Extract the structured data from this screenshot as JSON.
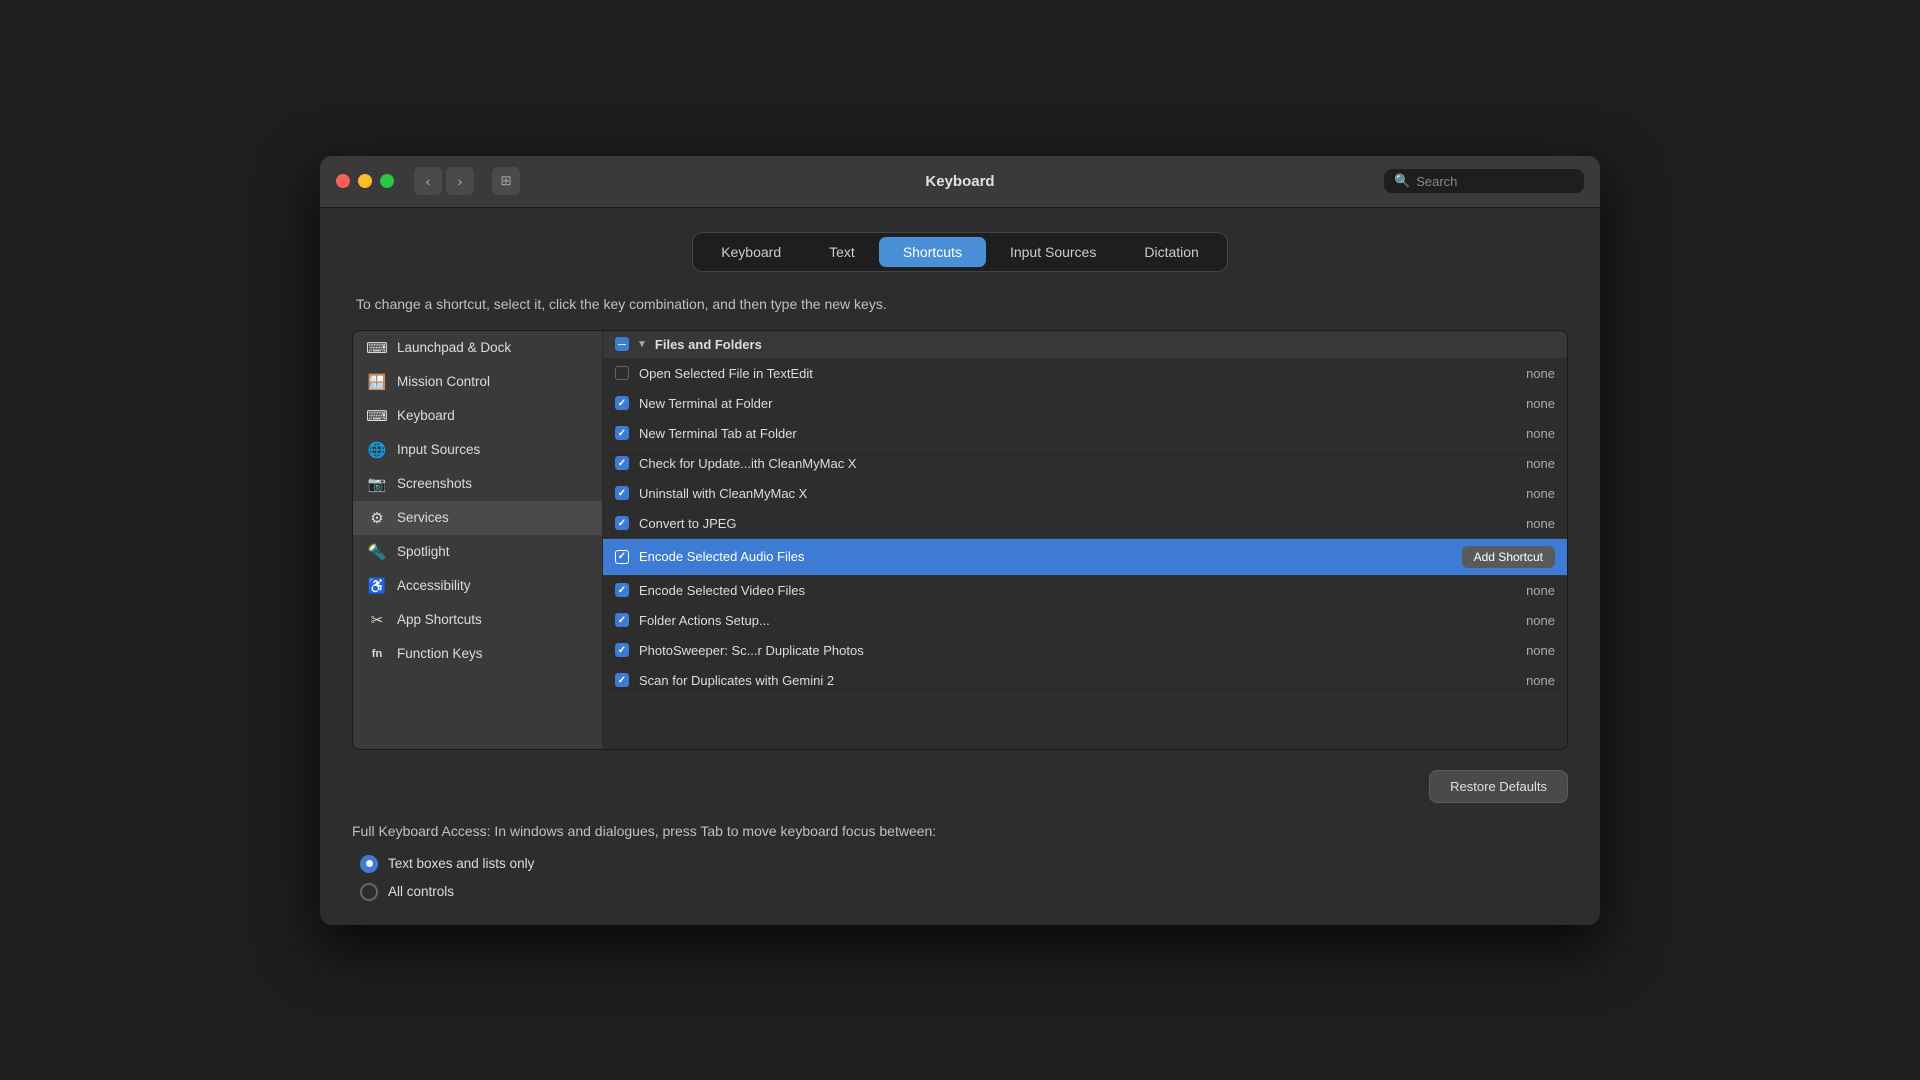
{
  "window": {
    "title": "Keyboard",
    "search_placeholder": "Search"
  },
  "tabs": [
    {
      "id": "keyboard",
      "label": "Keyboard",
      "active": false
    },
    {
      "id": "text",
      "label": "Text",
      "active": false
    },
    {
      "id": "shortcuts",
      "label": "Shortcuts",
      "active": true
    },
    {
      "id": "input-sources",
      "label": "Input Sources",
      "active": false
    },
    {
      "id": "dictation",
      "label": "Dictation",
      "active": false
    }
  ],
  "instruction": "To change a shortcut, select it, click the key combination, and then type the new keys.",
  "sidebar": {
    "items": [
      {
        "id": "launchpad",
        "label": "Launchpad & Dock",
        "icon": "⌨"
      },
      {
        "id": "mission-control",
        "label": "Mission Control",
        "icon": "🪟"
      },
      {
        "id": "keyboard",
        "label": "Keyboard",
        "icon": "⌨"
      },
      {
        "id": "input-sources",
        "label": "Input Sources",
        "icon": "🌐"
      },
      {
        "id": "screenshots",
        "label": "Screenshots",
        "icon": "📷"
      },
      {
        "id": "services",
        "label": "Services",
        "icon": "⚙",
        "active": true
      },
      {
        "id": "spotlight",
        "label": "Spotlight",
        "icon": "🔦"
      },
      {
        "id": "accessibility",
        "label": "Accessibility",
        "icon": "♿"
      },
      {
        "id": "app-shortcuts",
        "label": "App Shortcuts",
        "icon": "✂"
      },
      {
        "id": "function-keys",
        "label": "Function Keys",
        "icon": "fn"
      }
    ]
  },
  "group": {
    "label": "Files and Folders",
    "collapsed": false
  },
  "shortcuts": [
    {
      "id": "open-selected",
      "label": "Open Selected File in TextEdit",
      "key": "none",
      "checked": false
    },
    {
      "id": "new-terminal",
      "label": "New Terminal at Folder",
      "key": "none",
      "checked": true
    },
    {
      "id": "new-terminal-tab",
      "label": "New Terminal Tab at Folder",
      "key": "none",
      "checked": true
    },
    {
      "id": "check-update",
      "label": "Check for Update...ith CleanMyMac X",
      "key": "none",
      "checked": true
    },
    {
      "id": "uninstall",
      "label": "Uninstall with CleanMyMac X",
      "key": "none",
      "checked": true
    },
    {
      "id": "convert-jpeg",
      "label": "Convert to JPEG",
      "key": "none",
      "checked": true
    },
    {
      "id": "encode-audio",
      "label": "Encode Selected Audio Files",
      "key": "Add Shortcut",
      "checked": true,
      "selected": true
    },
    {
      "id": "encode-video",
      "label": "Encode Selected Video Files",
      "key": "none",
      "checked": true
    },
    {
      "id": "folder-actions",
      "label": "Folder Actions Setup...",
      "key": "none",
      "checked": true
    },
    {
      "id": "photosweeper",
      "label": "PhotoSweeper: Sc...r Duplicate Photos",
      "key": "none",
      "checked": true
    },
    {
      "id": "scan-duplicates",
      "label": "Scan for Duplicates with Gemini 2",
      "key": "none",
      "checked": true
    }
  ],
  "restore_button": "Restore Defaults",
  "keyboard_access": {
    "label": "Full Keyboard Access: In windows and dialogues, press Tab to move keyboard focus between:",
    "options": [
      {
        "id": "text-boxes",
        "label": "Text boxes and lists only",
        "selected": true
      },
      {
        "id": "all-controls",
        "label": "All controls",
        "selected": false
      }
    ]
  }
}
